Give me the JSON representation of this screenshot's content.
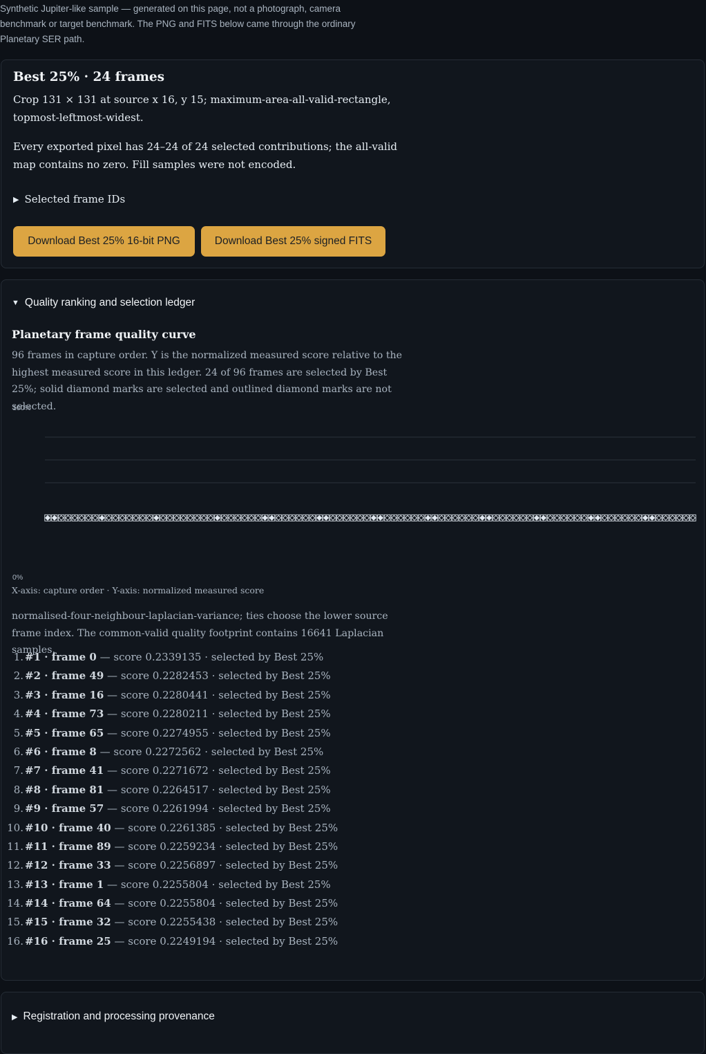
{
  "intro": {
    "text": "Synthetic Jupiter-like sample — generated on this page, not a photograph, camera benchmark or target benchmark. The PNG and FITS below came through the ordinary Planetary SER path."
  },
  "best": {
    "title": "Best 25% · 24 frames",
    "crop_text": "Crop 131 × 131 at source x 16, y 15; maximum-area-all-valid-rectangle, topmost-leftmost-widest.",
    "valid_text": "Every exported pixel has 24–24 of 24 selected contributions; the all-valid map contains no zero. Fill samples were not encoded.",
    "frames_summary": "Selected frame IDs",
    "download_png": "Download Best 25% 16-bit PNG",
    "download_fits": "Download Best 25% signed FITS"
  },
  "ledger": {
    "summary": "Quality ranking and selection ledger",
    "curve_title": "Planetary frame quality curve",
    "curve_desc": "96 frames in capture order. Y is the normalized measured score relative to the highest measured score in this ledger. 24 of 96 frames are selected by Best 25%; solid diamond marks are selected and outlined diamond marks are not selected.",
    "axis_caption": "X-axis: capture order · Y-axis: normalized measured score",
    "method": "normalised-four-neighbour-laplacian-variance; ties choose the lower source frame index. The common-valid quality footprint contains 16641 Laplacian samples.",
    "ranking": [
      {
        "num": "1.",
        "rank": "#1",
        "frame": "frame 0",
        "score": "— score 0.2339135 · selected by Best 25%"
      },
      {
        "num": "2.",
        "rank": "#2",
        "frame": "frame 49",
        "score": "— score 0.2282453 · selected by Best 25%"
      },
      {
        "num": "3.",
        "rank": "#3",
        "frame": "frame 16",
        "score": "— score 0.2280441 · selected by Best 25%"
      },
      {
        "num": "4.",
        "rank": "#4",
        "frame": "frame 73",
        "score": "— score 0.2280211 · selected by Best 25%"
      },
      {
        "num": "5.",
        "rank": "#5",
        "frame": "frame 65",
        "score": "— score 0.2274955 · selected by Best 25%"
      },
      {
        "num": "6.",
        "rank": "#6",
        "frame": "frame 8",
        "score": "— score 0.2272562 · selected by Best 25%"
      },
      {
        "num": "7.",
        "rank": "#7",
        "frame": "frame 41",
        "score": "— score 0.2271672 · selected by Best 25%"
      },
      {
        "num": "8.",
        "rank": "#8",
        "frame": "frame 81",
        "score": "— score 0.2264517 · selected by Best 25%"
      },
      {
        "num": "9.",
        "rank": "#9",
        "frame": "frame 57",
        "score": "— score 0.2261994 · selected by Best 25%"
      },
      {
        "num": "10.",
        "rank": "#10",
        "frame": "frame 40",
        "score": "— score 0.2261385 · selected by Best 25%"
      },
      {
        "num": "11.",
        "rank": "#11",
        "frame": "frame 89",
        "score": "— score 0.2259234 · selected by Best 25%"
      },
      {
        "num": "12.",
        "rank": "#12",
        "frame": "frame 33",
        "score": "— score 0.2256897 · selected by Best 25%"
      },
      {
        "num": "13.",
        "rank": "#13",
        "frame": "frame 1",
        "score": "— score 0.2255804 · selected by Best 25%"
      },
      {
        "num": "14.",
        "rank": "#14",
        "frame": "frame 64",
        "score": "— score 0.2255804 · selected by Best 25%"
      },
      {
        "num": "15.",
        "rank": "#15",
        "frame": "frame 32",
        "score": "— score 0.2255438 · selected by Best 25%"
      },
      {
        "num": "16.",
        "rank": "#16",
        "frame": "frame 25",
        "score": "— score 0.2249194 · selected by Best 25%"
      }
    ]
  },
  "provenance": {
    "summary": "Registration and processing provenance"
  },
  "chart_data": {
    "type": "scatter",
    "y_axis_top_label": "100%",
    "y_axis_bottom_label": "0%",
    "ylim": [
      0,
      100
    ],
    "frame_count": 96,
    "selected_frames": [
      0,
      1,
      8,
      16,
      25,
      32,
      33,
      40,
      41,
      48,
      49,
      56,
      57,
      64,
      65,
      72,
      73,
      80,
      81,
      88,
      89,
      96,
      97,
      104
    ],
    "normalized_score_percent": 26,
    "colors": {
      "grid": "#2a323c",
      "mark": "#dfe6ee"
    }
  }
}
